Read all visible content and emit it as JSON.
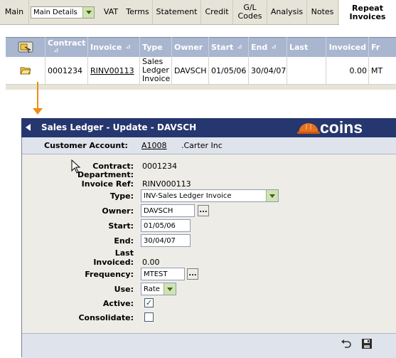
{
  "tabs": {
    "main": "Main",
    "details_selected": "Main Details",
    "vat": "VAT",
    "terms": "Terms",
    "statement": "Statement",
    "credit": "Credit",
    "gl_line1": "G/L",
    "gl_line2": "Codes",
    "analysis": "Analysis",
    "notes": "Notes",
    "repeat_line1": "Repeat",
    "repeat_line2": "Invoices"
  },
  "grid": {
    "headers": {
      "contract": "Contract",
      "invoice": "Invoice",
      "type": "Type",
      "owner": "Owner",
      "start": "Start",
      "end": "End",
      "last": "Last",
      "invoiced": "Invoiced",
      "fr": "Fr"
    },
    "sort_glyph": "⊿",
    "row": {
      "contract": "0001234",
      "invoice": "RINV00113",
      "type_l1": "Sales",
      "type_l2": "Ledger",
      "type_l3": "Invoice",
      "owner": "DAVSCH",
      "start": "01/05/06",
      "end": "30/04/07",
      "last": "",
      "invoiced": "0.00",
      "fr": "MT"
    }
  },
  "dialog": {
    "title": "Sales Ledger - Update - DAVSCH",
    "logo": "coins",
    "customer_account_label": "Customer Account:",
    "customer_account_code": "A1008",
    "customer_account_name": ".Carter Inc",
    "fields": {
      "contract_label": "Contract:",
      "contract_value": "0001234",
      "department_label": "Department:",
      "invoice_ref_label": "Invoice Ref:",
      "invoice_ref_value": "RINV000113",
      "type_label": "Type:",
      "type_value": "INV-Sales Ledger Invoice",
      "owner_label": "Owner:",
      "owner_value": "DAVSCH",
      "start_label": "Start:",
      "start_value": "01/05/06",
      "end_label": "End:",
      "end_value": "30/04/07",
      "last_label": "Last",
      "invoiced_label": "Invoiced:",
      "invoiced_value": "0.00",
      "frequency_label": "Frequency:",
      "frequency_value": "MTEST",
      "use_label": "Use:",
      "use_value": "Rate",
      "active_label": "Active:",
      "active_checked": true,
      "consolidate_label": "Consolidate:",
      "consolidate_checked": false
    },
    "ellipsis": "...",
    "check_glyph": "✓"
  },
  "colors": {
    "title_bar": "#26366e",
    "grid_header": "#a9b6cf",
    "arrow": "#f08c10",
    "logo_hardhat": "#e8701e"
  },
  "icons": [
    "grid-options-icon",
    "folder-open-icon",
    "back-arrow-icon",
    "hardhat-logo-icon",
    "undo-icon",
    "save-disk-icon",
    "mouse-pointer-icon"
  ]
}
